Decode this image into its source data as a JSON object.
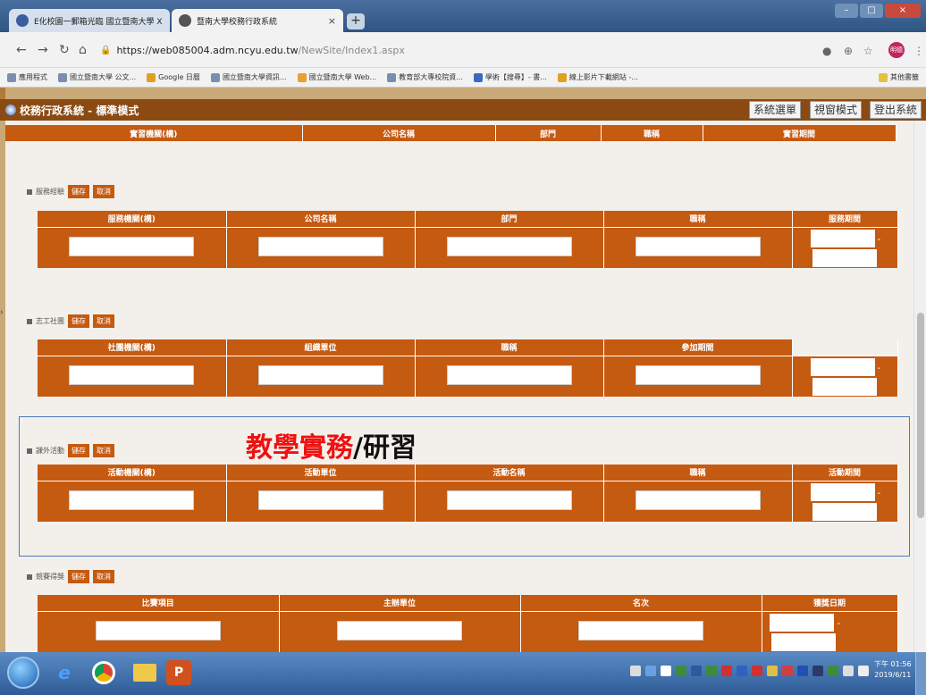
{
  "browser": {
    "tabs": [
      {
        "title": "E化校園一郵箱光臨 國立暨南大學 X",
        "active": false
      },
      {
        "title": "暨南大學校務行政系統",
        "active": true
      }
    ],
    "url_host": "https://web085004.adm.ncyu.edu.tw",
    "url_path": "/NewSite/Index1.aspx",
    "avatar": "明德",
    "bookmarks": [
      "應用程式",
      "國立暨南大學 公文...",
      "Google 日曆",
      "國立暨南大學資訊...",
      "國立暨南大學 Web...",
      "教育部大專校院資...",
      "學術【搜尋】- 書...",
      "線上影片下載網站 -...",
      "其他書籤"
    ]
  },
  "app": {
    "title": "校務行政系統 - 標準模式",
    "buttons": [
      "系統選單",
      "視窗模式",
      "登出系統"
    ]
  },
  "overlay": {
    "red": "教學實務",
    "black": "/研習"
  },
  "top_table": {
    "headers": [
      "實習機關(構)",
      "公司名稱",
      "部門",
      "職稱",
      "實習期間"
    ]
  },
  "sections": [
    {
      "label": "服務經驗",
      "save": "儲存",
      "cancel": "取消",
      "headers": [
        "服務機關(構)",
        "公司名稱",
        "部門",
        "職稱",
        "服務期間"
      ]
    },
    {
      "label": "志工社團",
      "save": "儲存",
      "cancel": "取消",
      "headers": [
        "社團機關(構)",
        "組織單位",
        "職稱",
        "參加期間"
      ]
    },
    {
      "label": "課外活動",
      "save": "儲存",
      "cancel": "取消",
      "headers": [
        "活動機關(構)",
        "活動單位",
        "活動名稱",
        "職稱",
        "活動期間"
      ]
    },
    {
      "label": "競賽得獎",
      "save": "儲存",
      "cancel": "取消",
      "headers": [
        "比賽項目",
        "主辦單位",
        "名次",
        "獲獎日期"
      ]
    }
  ],
  "taskbar": {
    "clock_time": "下午 01:56",
    "clock_date": "2019/6/11"
  },
  "colors": {
    "accent": "#c55a11",
    "header": "#8a4a12",
    "highlight": "#4a7ac0"
  }
}
